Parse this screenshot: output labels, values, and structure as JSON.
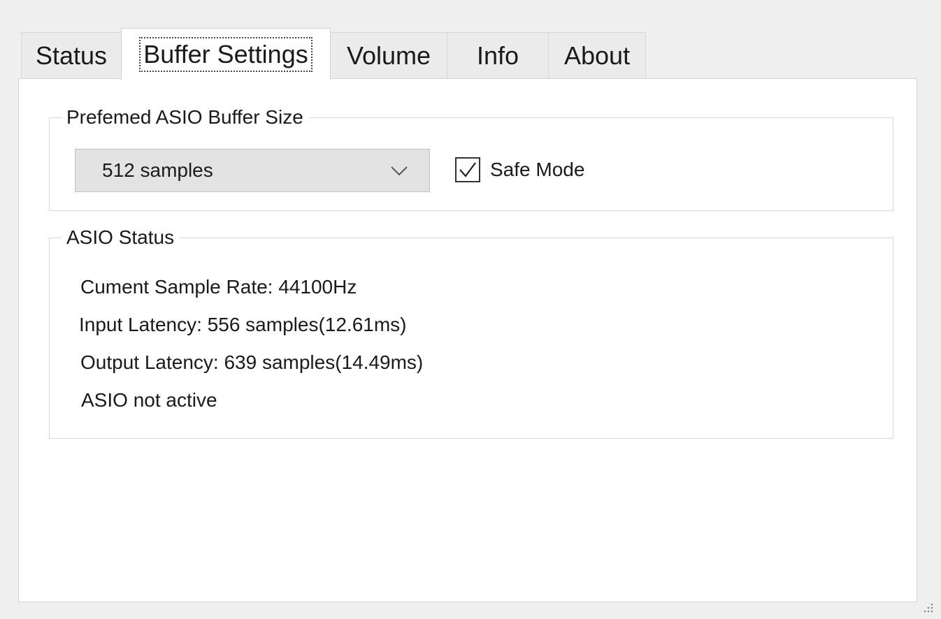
{
  "tabs": [
    {
      "label": "Status",
      "active": false
    },
    {
      "label": "Buffer Settings",
      "active": true
    },
    {
      "label": "Volume",
      "active": false
    },
    {
      "label": "Info",
      "active": false
    },
    {
      "label": "About",
      "active": false
    }
  ],
  "buffer_group": {
    "title": "Prefemed ASIO Buffer Size",
    "buffer_size": {
      "selected": "512 samples"
    },
    "safe_mode": {
      "label": "Safe Mode",
      "checked": true
    }
  },
  "status_group": {
    "title": "ASIO Status",
    "lines": [
      "Cument Sample Rate: 44100Hz",
      "Input Latency: 556 samples(12.61ms)",
      "Output Latency: 639 samples(14.49ms)",
      "ASIO not active"
    ]
  },
  "icons": {
    "dropdown": "chevron-down-icon",
    "checkbox": "checkmark-icon",
    "resize": "resize-grip-icon"
  }
}
